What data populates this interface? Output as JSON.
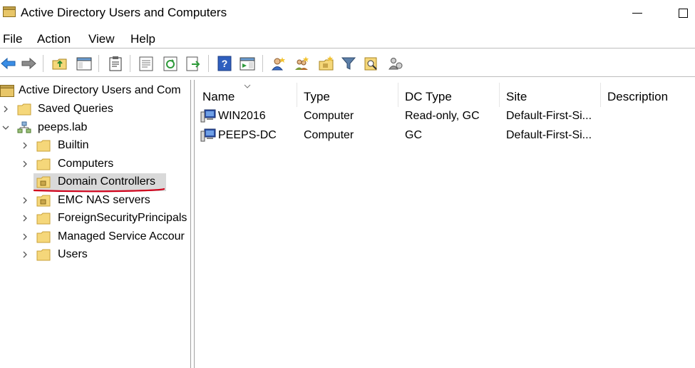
{
  "window": {
    "title": "Active Directory Users and Computers"
  },
  "menu": [
    "File",
    "Action",
    "View",
    "Help"
  ],
  "toolbar": {
    "buttons": [
      "back-arrow-icon",
      "forward-arrow-icon",
      "up-folder-icon",
      "show-console-tree-icon",
      "clipboard-icon",
      "properties-icon",
      "refresh-icon",
      "export-list-icon",
      "help-icon",
      "action-pane-icon",
      "new-user-icon",
      "new-group-icon",
      "new-ou-icon",
      "filter-icon",
      "find-icon",
      "add-to-group-icon"
    ]
  },
  "tree": {
    "root": "Active Directory Users and Com",
    "items": [
      {
        "label": "Saved Queries",
        "level": 1,
        "expander": "collapsed"
      },
      {
        "label": "peeps.lab",
        "level": 1,
        "expander": "expanded"
      },
      {
        "label": "Builtin",
        "level": 2,
        "expander": "collapsed"
      },
      {
        "label": "Computers",
        "level": 2,
        "expander": "collapsed"
      },
      {
        "label": "Domain Controllers",
        "level": 2,
        "expander": "none",
        "selected": true
      },
      {
        "label": "EMC NAS servers",
        "level": 2,
        "expander": "collapsed"
      },
      {
        "label": "ForeignSecurityPrincipals",
        "level": 2,
        "expander": "collapsed"
      },
      {
        "label": "Managed Service Accour",
        "level": 2,
        "expander": "collapsed"
      },
      {
        "label": "Users",
        "level": 2,
        "expander": "collapsed"
      }
    ]
  },
  "list": {
    "columns": [
      "Name",
      "Type",
      "DC Type",
      "Site",
      "Description"
    ],
    "rows": [
      {
        "name": "WIN2016",
        "type": "Computer",
        "dc_type": "Read-only, GC",
        "site": "Default-First-Si...",
        "description": ""
      },
      {
        "name": "PEEPS-DC",
        "type": "Computer",
        "dc_type": "GC",
        "site": "Default-First-Si...",
        "description": ""
      }
    ]
  },
  "colors": {
    "selection": "#d9d9d9",
    "annotation": "#d0021b",
    "folder": "#f5d77a"
  }
}
